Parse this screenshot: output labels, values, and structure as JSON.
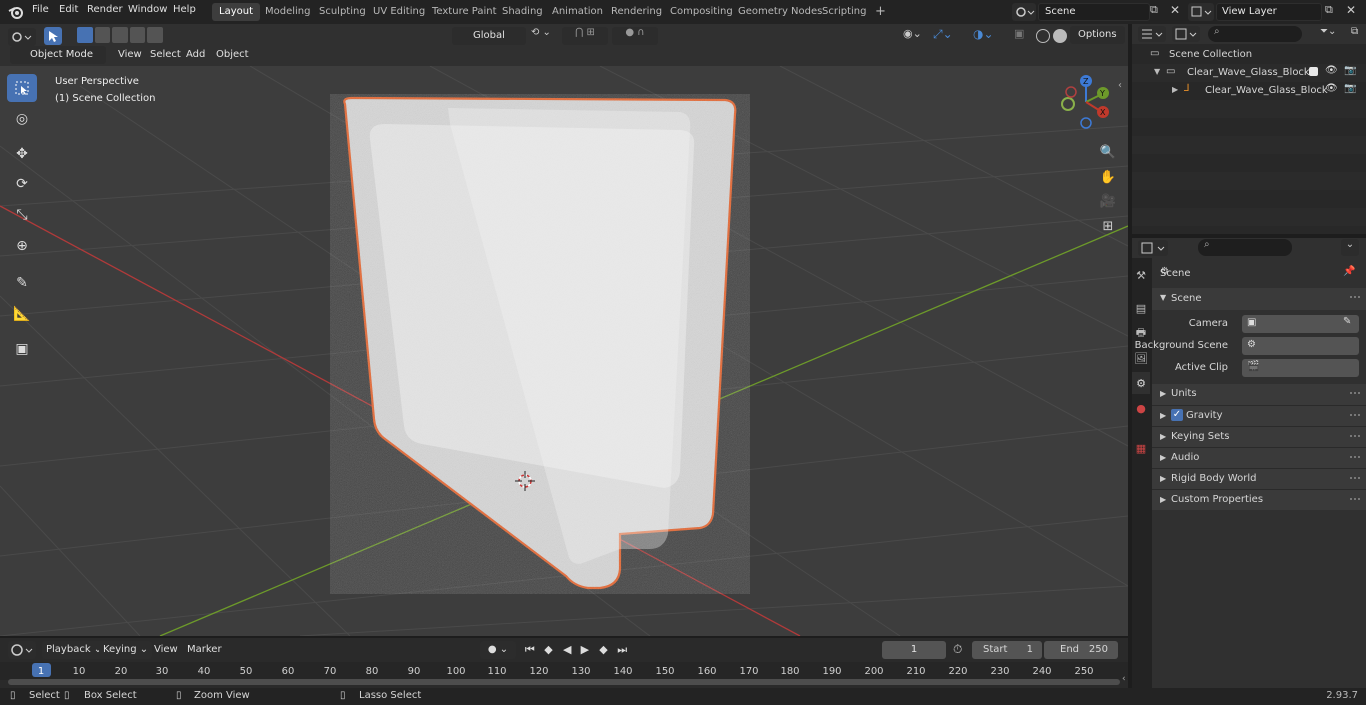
{
  "topbar": {
    "menus": [
      "File",
      "Edit",
      "Render",
      "Window",
      "Help"
    ],
    "workspaces": [
      "Layout",
      "Modeling",
      "Sculpting",
      "UV Editing",
      "Texture Paint",
      "Shading",
      "Animation",
      "Rendering",
      "Compositing",
      "Geometry Nodes",
      "Scripting"
    ],
    "active_workspace": "Layout",
    "add_tab": "+",
    "scene_name": "Scene",
    "view_layer": "View Layer"
  },
  "viewport_header": {
    "mode": "Object Mode",
    "menus": [
      "View",
      "Select",
      "Add",
      "Object"
    ],
    "orientation": "Global",
    "options": "Options"
  },
  "viewport": {
    "perspective_label": "User Perspective",
    "collection_label": "(1) Scene Collection",
    "gizmo_axes": [
      "Z",
      "Y",
      "X"
    ]
  },
  "outliner": {
    "root": "Scene Collection",
    "items": [
      {
        "label": "Clear_Wave_Glass_Block",
        "kind": "collection"
      },
      {
        "label": "Clear_Wave_Glass_Block",
        "kind": "object"
      }
    ]
  },
  "properties": {
    "context": "Scene",
    "panel": "Scene",
    "fields": [
      {
        "label": "Camera"
      },
      {
        "label": "Background Scene"
      },
      {
        "label": "Active Clip"
      }
    ],
    "subpanels": [
      "Units",
      "Gravity",
      "Keying Sets",
      "Audio",
      "Rigid Body World",
      "Custom Properties"
    ],
    "gravity_enabled": true
  },
  "timeline": {
    "menus": [
      "Playback",
      "Keying",
      "View",
      "Marker"
    ],
    "current_frame": "1",
    "start_label": "Start",
    "start_value": "1",
    "end_label": "End",
    "end_value": "250",
    "ruler_ticks": [
      "1",
      "10",
      "20",
      "30",
      "40",
      "50",
      "60",
      "70",
      "80",
      "90",
      "100",
      "110",
      "120",
      "130",
      "140",
      "150",
      "160",
      "170",
      "180",
      "190",
      "200",
      "210",
      "220",
      "230",
      "240",
      "250"
    ]
  },
  "statusbar": {
    "select": "Select",
    "box_select": "Box Select",
    "zoom_view": "Zoom View",
    "lasso_select": "Lasso Select",
    "version": "2.93.7"
  },
  "colors": {
    "accent": "#4772b3",
    "selection_outline": "#e8622a",
    "axis_x": "#c0392b",
    "axis_y": "#6d9a2a",
    "axis_z": "#3d7ad6"
  }
}
